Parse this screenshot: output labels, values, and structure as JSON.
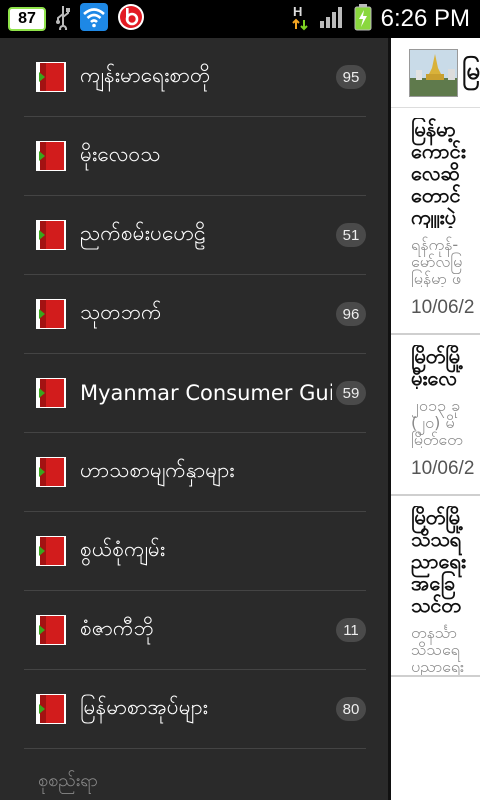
{
  "status_bar": {
    "battery_level": "87",
    "time": "6:26 PM",
    "icons": [
      "battery-badge-icon",
      "usb-icon",
      "wifi-icon",
      "beats-audio-icon",
      "hspa-data-icon",
      "signal-strength-icon",
      "battery-charging-icon"
    ]
  },
  "sidebar": {
    "items": [
      {
        "label": "ကျန်းမာရေးစာတို",
        "count": "95"
      },
      {
        "label": "မိုးလေဝသ",
        "count": ""
      },
      {
        "label": "ညက်စမ်းပဟေဠိ",
        "count": "51"
      },
      {
        "label": "သုတဘက်",
        "count": "96"
      },
      {
        "label": "Myanmar Consumer Guide",
        "count": "59"
      },
      {
        "label": "ဟာသစာမျက်နှာများ",
        "count": ""
      },
      {
        "label": "စွယ်စုံကျမ်း",
        "count": ""
      },
      {
        "label": "စံဇာကီဘို",
        "count": "11"
      },
      {
        "label": "မြန်မာစာအုပ်များ",
        "count": "80"
      }
    ],
    "footer": "စုစည်းရာ"
  },
  "content": {
    "header_title": "မြ",
    "articles": [
      {
        "title": "မြန်မာ့\nကောင်း\nလေဆိ\nတောင်\nကျူးပဲ့",
        "excerpt": "ရန်ကုန်-\nမော်လမြ\nမြန်မာ့ ဖ",
        "date": "10/06/2"
      },
      {
        "title": "မြိတ်မြို့\nမိုးလေ",
        "excerpt": "၂၀၁၃ ခု\n(၂၀) မိ\nမြိတ်တေ",
        "date": "10/06/2"
      },
      {
        "title": "မြိတ်မြို့\nသိသရ\nညာရေး\nအခြေ\nသင်တ",
        "excerpt": "တနင်္သာ\nသိသရေ\nပညာရေး",
        "date": ""
      }
    ]
  },
  "colors": {
    "sidebar_bg": "#2a2a2a",
    "divider": "#444444",
    "badge_bg": "#4a4a4a",
    "book_red": "#d21c1c",
    "arrow_green": "#3aa61d"
  }
}
